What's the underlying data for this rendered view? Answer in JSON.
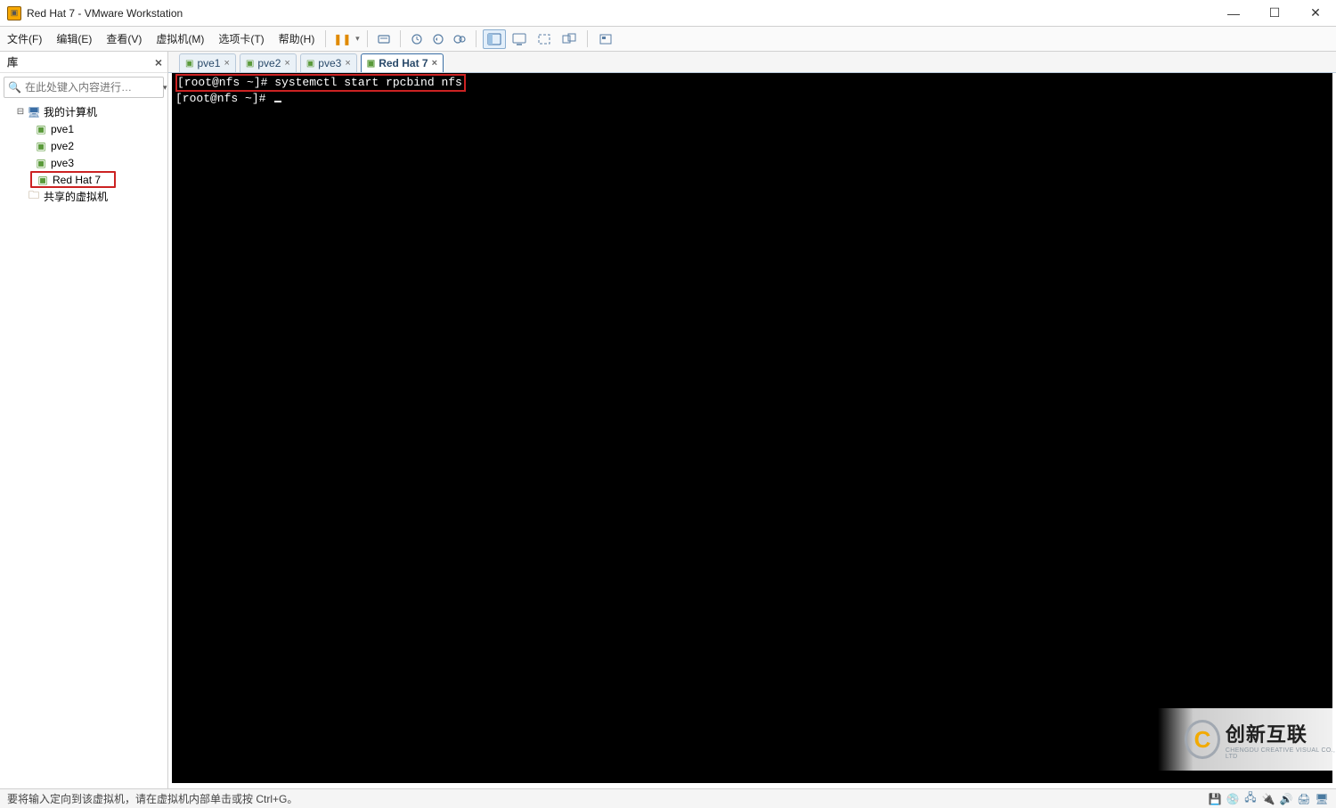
{
  "window": {
    "title": "Red Hat 7 - VMware Workstation"
  },
  "menu": {
    "file": "文件(F)",
    "edit": "编辑(E)",
    "view": "查看(V)",
    "vm": "虚拟机(M)",
    "tabs": "选项卡(T)",
    "help": "帮助(H)"
  },
  "sidebar": {
    "header": "库",
    "search_placeholder": "在此处键入内容进行…",
    "root": "我的计算机",
    "items": [
      "pve1",
      "pve2",
      "pve3",
      "Red Hat 7"
    ],
    "selected": "Red Hat 7",
    "shared": "共享的虚拟机"
  },
  "tabs": [
    {
      "label": "pve1",
      "active": false
    },
    {
      "label": "pve2",
      "active": false
    },
    {
      "label": "pve3",
      "active": false
    },
    {
      "label": "Red Hat 7",
      "active": true
    }
  ],
  "terminal": {
    "line1": "[root@nfs ~]# systemctl start rpcbind nfs",
    "line2_prompt": "[root@nfs ~]# "
  },
  "statusbar": {
    "text": "要将输入定向到该虚拟机，请在虚拟机内部单击或按 Ctrl+G。"
  },
  "watermark": {
    "big": "创新互联",
    "small": "CHENGDU CREATIVE VISUAL CO., LTD"
  }
}
